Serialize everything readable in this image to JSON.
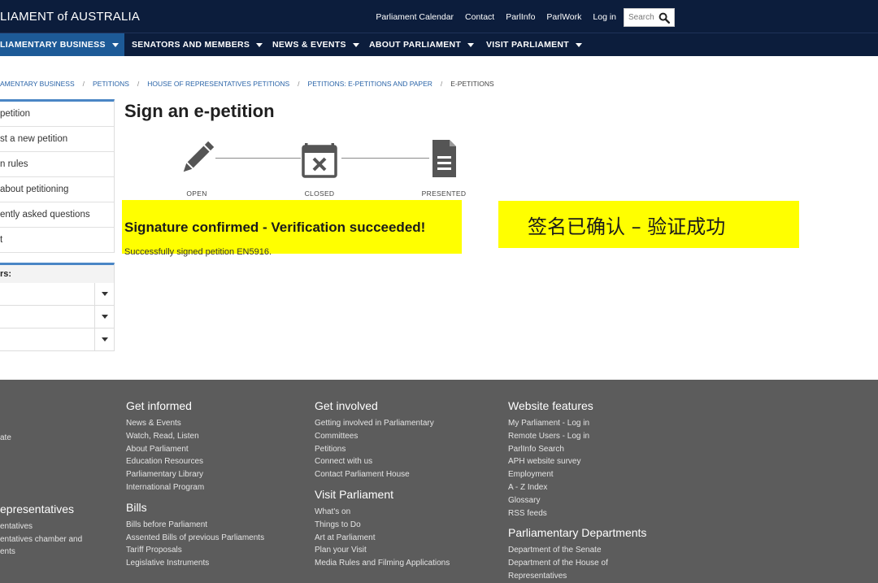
{
  "header": {
    "site_title": "LIAMENT of AUSTRALIA",
    "util_links": [
      "Parliament Calendar",
      "Contact",
      "ParlInfo",
      "ParlWork",
      "Log in"
    ],
    "search_placeholder": "Search"
  },
  "nav": {
    "items": [
      {
        "label": "LIAMENTARY BUSINESS"
      },
      {
        "label": "SENATORS AND MEMBERS"
      },
      {
        "label": "NEWS & EVENTS"
      },
      {
        "label": "ABOUT PARLIAMENT"
      },
      {
        "label": "VISIT PARLIAMENT"
      }
    ]
  },
  "breadcrumb": [
    "AMENTARY BUSINESS",
    "PETITIONS",
    "HOUSE OF REPRESENTATIVES PETITIONS",
    "PETITIONS: E-PETITIONS AND PAPER",
    "E-PETITIONS"
  ],
  "sidebar": {
    "items": [
      "petition",
      "st a new petition",
      "n rules",
      "about petitioning",
      "ently asked questions",
      "t"
    ],
    "filters_title": "rs:"
  },
  "main": {
    "title": "Sign an e-petition",
    "steps": [
      "OPEN",
      "CLOSED",
      "PRESENTED"
    ],
    "confirm_title": "Signature confirmed - Verification succeeded!",
    "confirm_sub": "Successfully signed petition EN5916.",
    "cn_text": "签名已确认 – 验证成功"
  },
  "footer": {
    "col1": {
      "links": [
        "ate"
      ],
      "head2": "epresentatives",
      "links2": [
        "entatives",
        "entatives chamber and",
        "ents"
      ]
    },
    "col2": {
      "head": "Get informed",
      "links": [
        "News & Events",
        "Watch, Read, Listen",
        "About Parliament",
        "Education Resources",
        "Parliamentary Library",
        "International Program"
      ],
      "head2": "Bills",
      "links2": [
        "Bills before Parliament",
        "Assented Bills of previous Parliaments",
        "Tariff Proposals",
        "Legislative Instruments"
      ]
    },
    "col3": {
      "head": "Get involved",
      "links": [
        "Getting involved in Parliamentary",
        "Committees",
        "Petitions",
        "Connect with us",
        "Contact Parliament House"
      ],
      "head2": "Visit Parliament",
      "links2": [
        "What's on",
        "Things to Do",
        "Art at Parliament",
        "Plan your Visit",
        "Media Rules and Filming Applications"
      ]
    },
    "col4": {
      "head": "Website features",
      "links": [
        "My Parliament - Log in",
        "Remote Users - Log in",
        "ParlInfo Search",
        "APH website survey",
        "Employment",
        "A - Z Index",
        "Glossary",
        "RSS feeds"
      ],
      "head2": "Parliamentary Departments",
      "links2": [
        "Department of the Senate",
        "Department of the House of",
        "Representatives"
      ]
    }
  },
  "colors": {
    "header_bg": "#0c1d3c",
    "nav_active": "#1d5a97",
    "highlight": "#ffff00",
    "footer_bg": "#5c5c5c",
    "link": "#2a64a8"
  }
}
